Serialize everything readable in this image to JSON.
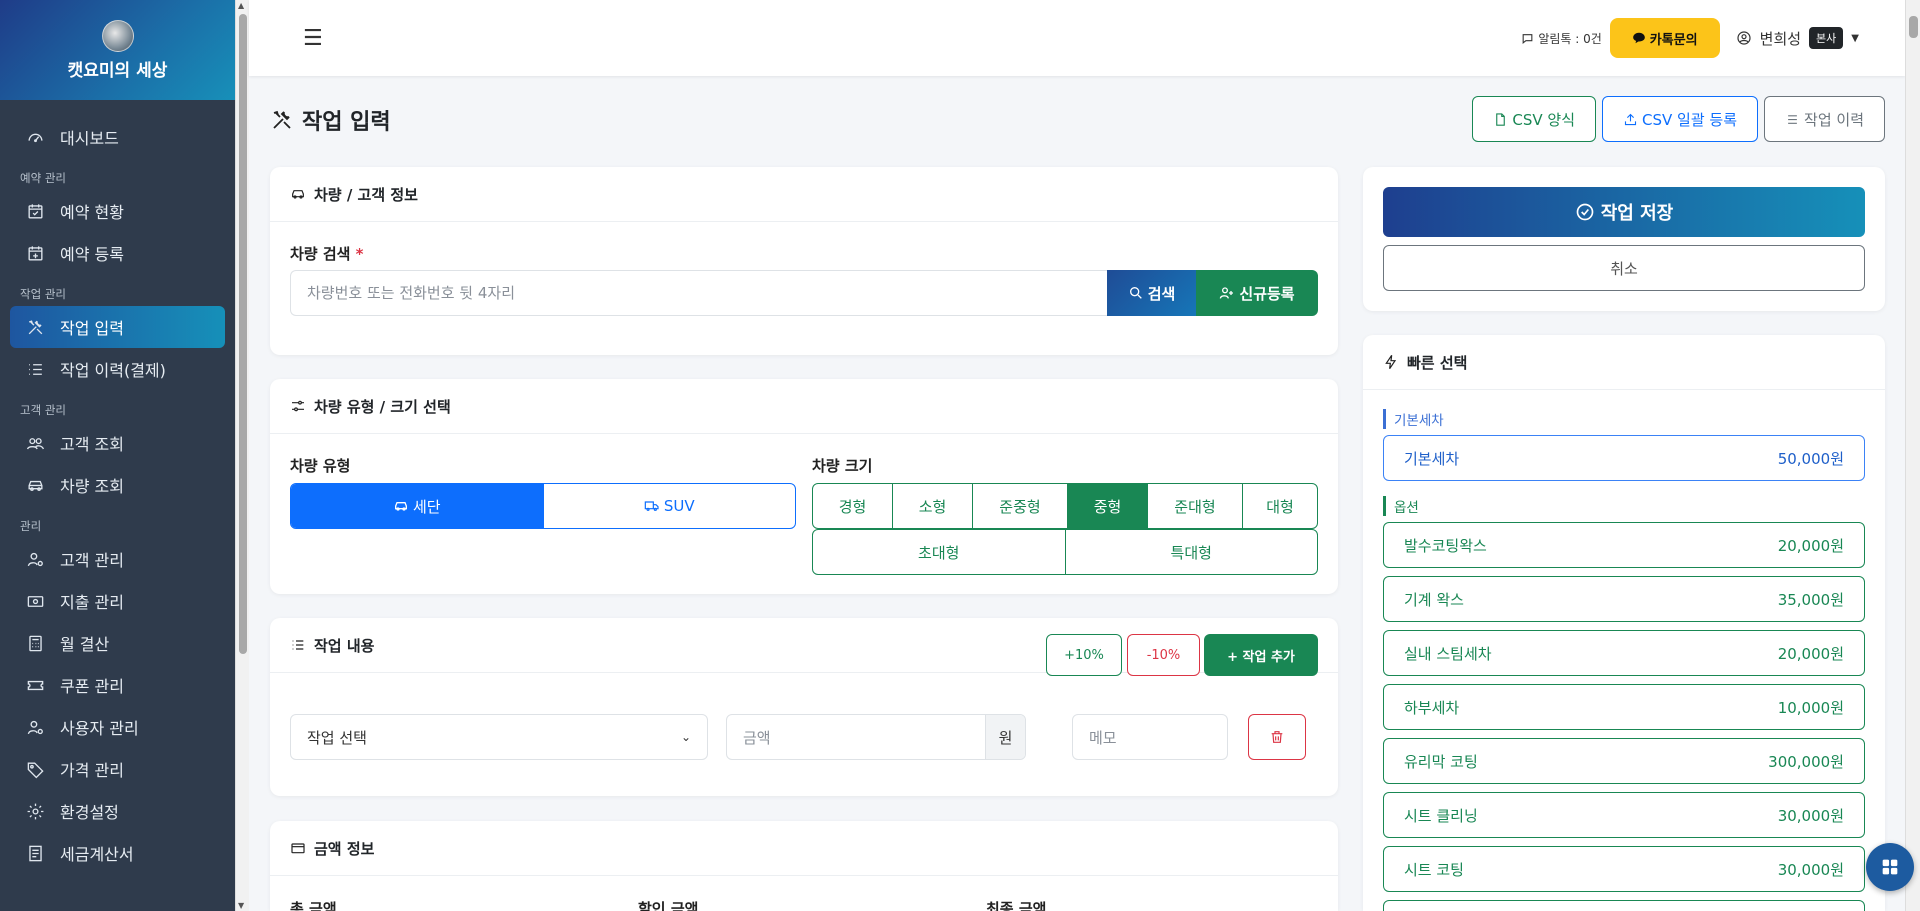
{
  "brand": {
    "name": "캣요미의 세상"
  },
  "sidebar": {
    "dashboard": "대시보드",
    "sections": {
      "reservation": "예약 관리",
      "work": "작업 관리",
      "customer": "고객 관리",
      "manage": "관리"
    },
    "items": {
      "reservation_status": "예약 현황",
      "reservation_register": "예약 등록",
      "work_input": "작업 입력",
      "work_history": "작업 이력(결제)",
      "customer_lookup": "고객 조회",
      "vehicle_lookup": "차량 조회",
      "customer_manage": "고객 관리",
      "expense_manage": "지출 관리",
      "monthly_settlement": "월 결산",
      "coupon_manage": "쿠폰 관리",
      "user_manage": "사용자 관리",
      "price_manage": "가격 관리",
      "settings": "환경설정",
      "tax_invoice": "세금계산서"
    }
  },
  "topbar": {
    "alim_label": "알림톡 : 0건",
    "kakao_button": "카톡문의",
    "user_name": "변희성",
    "user_badge": "본사"
  },
  "page": {
    "title": "작업 입력",
    "csv_template": "CSV 양식",
    "csv_bulk": "CSV 일괄 등록",
    "work_history": "작업 이력"
  },
  "vehicle_card": {
    "title": "차량 / 고객 정보",
    "search_label": "차량 검색",
    "required_mark": "*",
    "search_placeholder": "차량번호 또는 전화번호 뒷 4자리",
    "search_button": "검색",
    "new_button": "신규등록"
  },
  "type_card": {
    "title": "차량 유형 / 크기 선택",
    "type_label": "차량 유형",
    "types": [
      "세단",
      "SUV"
    ],
    "selected_type": "세단",
    "size_label": "차량 크기",
    "sizes_row1": [
      "경형",
      "소형",
      "준중형",
      "중형",
      "준대형",
      "대형"
    ],
    "sizes_row2": [
      "초대형",
      "특대형"
    ],
    "selected_size": "중형"
  },
  "work_card": {
    "title": "작업 내용",
    "plus10": "+10%",
    "minus10": "-10%",
    "add_button": "+ 작업 추가",
    "work_select": "작업 선택",
    "amount_placeholder": "금액",
    "currency": "원",
    "memo_placeholder": "메모"
  },
  "amount_card": {
    "title": "금액 정보",
    "total": "총 금액",
    "discount": "할인 금액",
    "final": "최종 금액"
  },
  "actions": {
    "save": "작업 저장",
    "cancel": "취소"
  },
  "quick": {
    "title": "빠른 선택",
    "basic_group": "기본세차",
    "option_group": "옵션",
    "basic_items": [
      {
        "name": "기본세차",
        "price": "50,000원"
      }
    ],
    "option_items": [
      {
        "name": "발수코팅왁스",
        "price": "20,000원"
      },
      {
        "name": "기계 왁스",
        "price": "35,000원"
      },
      {
        "name": "실내 스팀세차",
        "price": "20,000원"
      },
      {
        "name": "하부세차",
        "price": "10,000원"
      },
      {
        "name": "유리막 코팅",
        "price": "300,000원"
      },
      {
        "name": "시트 클리닝",
        "price": "30,000원"
      },
      {
        "name": "시트 코팅",
        "price": "30,000원"
      }
    ]
  },
  "colors": {
    "sidebar_bg": "#2f3b4c",
    "primary": "#0d6efd",
    "success": "#198754",
    "kakao": "#fcc419"
  }
}
